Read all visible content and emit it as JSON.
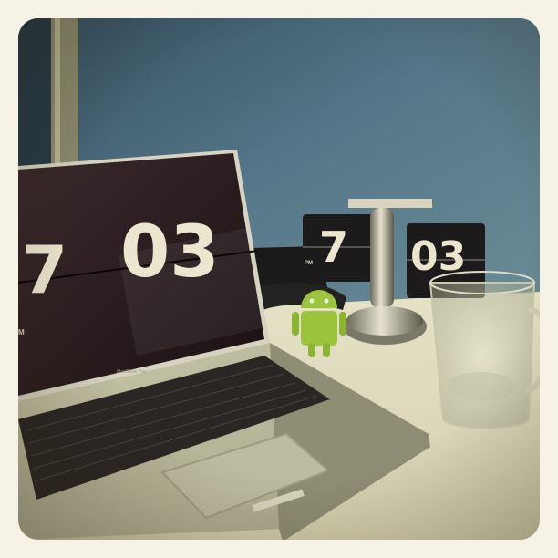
{
  "scene": {
    "laptop_screen": {
      "hour": "7",
      "minutes": "03",
      "meridiem": "M"
    },
    "laptop_brand": "MacBook Pro",
    "desk_clock": {
      "hour": "7",
      "minutes": "03",
      "meridiem": "PM"
    },
    "colors": {
      "wall": "#4f6c78",
      "desk": "#ddd9bf",
      "laptop_body": "#b9b79c",
      "screen": "#2a1c1e",
      "android": "#9cc43c"
    }
  }
}
